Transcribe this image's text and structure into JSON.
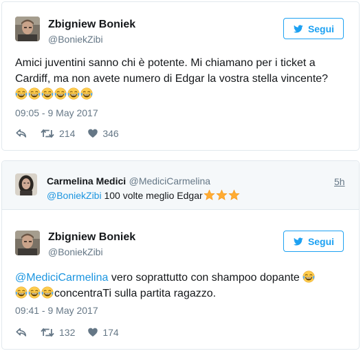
{
  "tweet1": {
    "author_name": "Zbigniew Boniek",
    "author_handle": "@BoniekZibi",
    "follow_label": "Segui",
    "text": "Amici juventini sanno chi è potente. Mi chiamano per i ticket a Cardiff, ma non avete numero di Edgar la vostra stella vincente?",
    "emoji_count": 6,
    "timestamp": "09:05 - 9 May 2017",
    "retweets": "214",
    "likes": "346"
  },
  "reply": {
    "author_name": "Carmelina Medici",
    "author_handle": "@MediciCarmelina",
    "age": "5h",
    "mention": "@BoniekZibi",
    "text": "100 volte meglio Edgar",
    "star_count": 3
  },
  "tweet2": {
    "author_name": "Zbigniew Boniek",
    "author_handle": "@BoniekZibi",
    "follow_label": "Segui",
    "mention": "@MediciCarmelina",
    "text_line1": "vero soprattutto con shampoo dopante",
    "text_line2": "concentraTi sulla partita ragazzo.",
    "timestamp": "09:41 - 9 May 2017",
    "retweets": "132",
    "likes": "174"
  },
  "icons": {
    "twitter_bird": "twitter-bird-icon",
    "reply": "reply-icon",
    "retweet": "retweet-icon",
    "like": "heart-icon",
    "emoji": "face-tears-of-joy-icon",
    "star": "star-icon"
  },
  "colors": {
    "accent": "#1da1f2",
    "mention": "#1b95e0",
    "muted": "#657786",
    "border": "#e1e8ed",
    "reply_bg": "#f5f8fa"
  }
}
